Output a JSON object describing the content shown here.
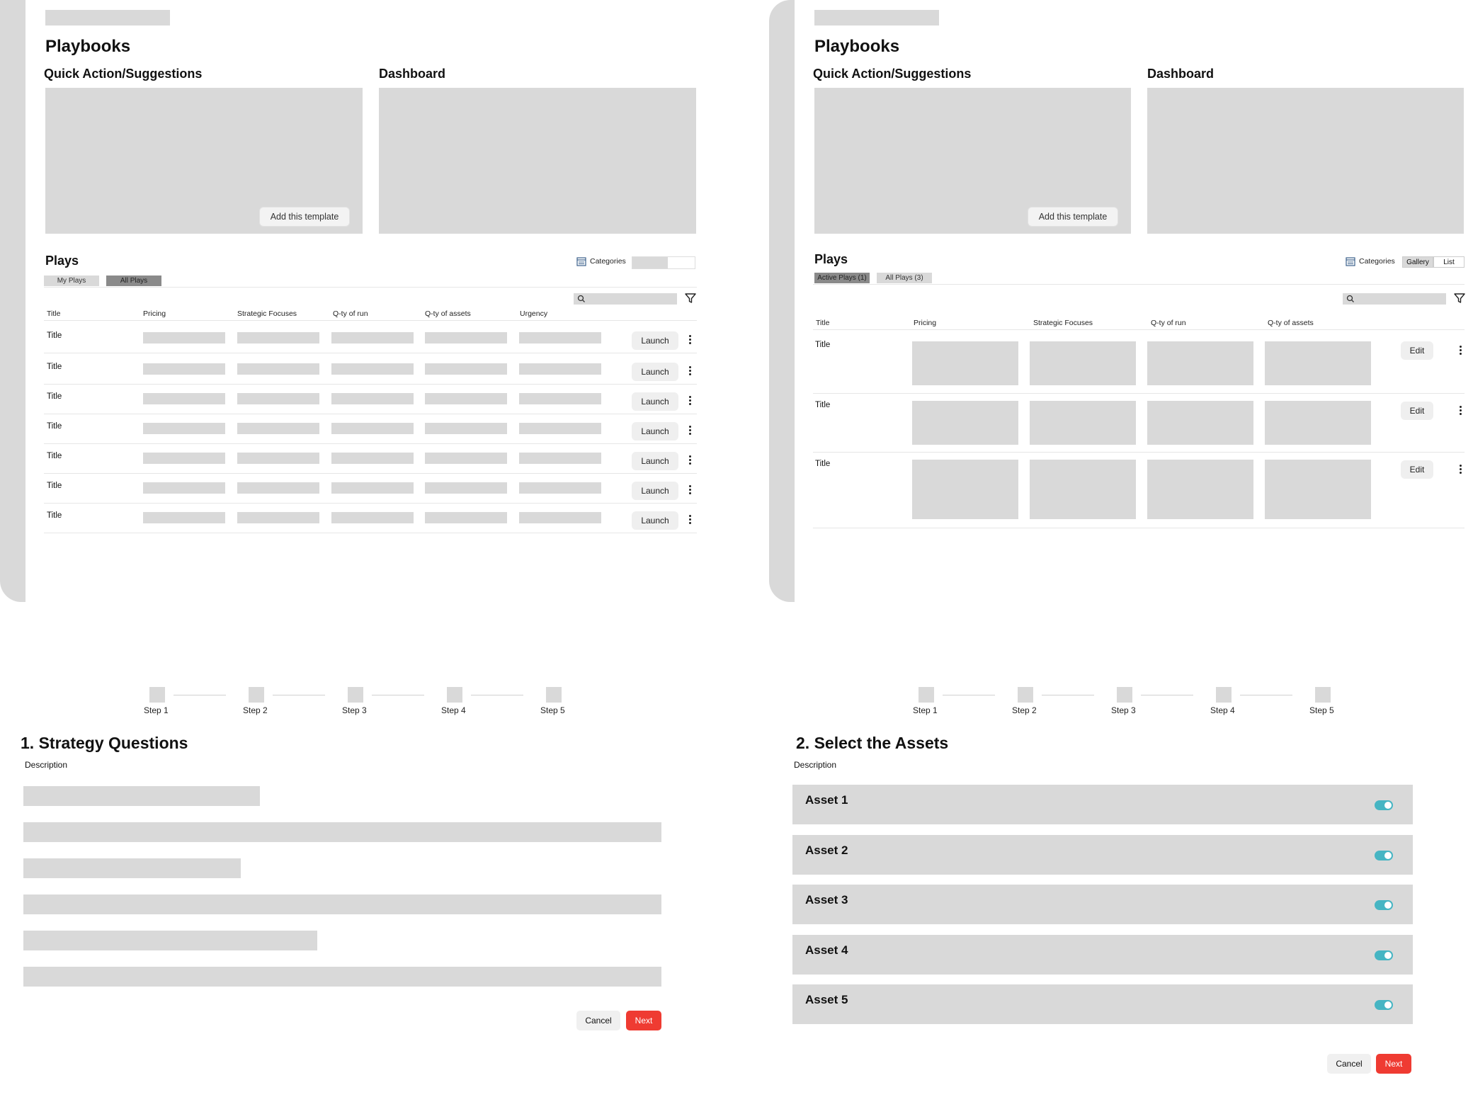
{
  "left_panel": {
    "page_title": "Playbooks",
    "quick_actions_title": "Quick Action/Suggestions",
    "dashboard_title": "Dashboard",
    "add_template_label": "Add this template",
    "plays_title": "Plays",
    "categories_label": "Categories",
    "tabs": [
      "My Plays",
      "All Plays"
    ],
    "columns": [
      "Title",
      "Pricing",
      "Strategic Focuses",
      "Q-ty of run",
      "Q-ty of assets",
      "Urgency"
    ],
    "rows": [
      "Title",
      "Title",
      "Title",
      "Title",
      "Title",
      "Title",
      "Title"
    ],
    "row_action": "Launch"
  },
  "right_panel": {
    "page_title": "Playbooks",
    "quick_actions_title": "Quick Action/Suggestions",
    "dashboard_title": "Dashboard",
    "add_template_label": "Add this template",
    "plays_title": "Plays",
    "categories_label": "Categories",
    "view_options": [
      "Gallery",
      "List"
    ],
    "tabs": [
      "Active Plays (1)",
      "All Plays (3)"
    ],
    "columns": [
      "Title",
      "Pricing",
      "Strategic Focuses",
      "Q-ty of run",
      "Q-ty of assets"
    ],
    "rows": [
      "Title",
      "Title",
      "Title"
    ],
    "row_action": "Edit"
  },
  "wizard_left": {
    "steps": [
      "Step 1",
      "Step 2",
      "Step 3",
      "Step 4",
      "Step 5"
    ],
    "title": "1. Strategy Questions",
    "description": "Description",
    "cancel_label": "Cancel",
    "next_label": "Next"
  },
  "wizard_right": {
    "steps": [
      "Step 1",
      "Step 2",
      "Step 3",
      "Step 4",
      "Step 5"
    ],
    "title": "2. Select the Assets",
    "description": "Description",
    "assets": [
      "Asset 1",
      "Asset 2",
      "Asset 3",
      "Asset 4",
      "Asset 5"
    ],
    "cancel_label": "Cancel",
    "next_label": "Next"
  },
  "colors": {
    "placeholder": "#d9d9d9",
    "toggle_on": "#46b5c3",
    "next_button": "#ef3b32",
    "active_tab": "#8a8a8a"
  }
}
